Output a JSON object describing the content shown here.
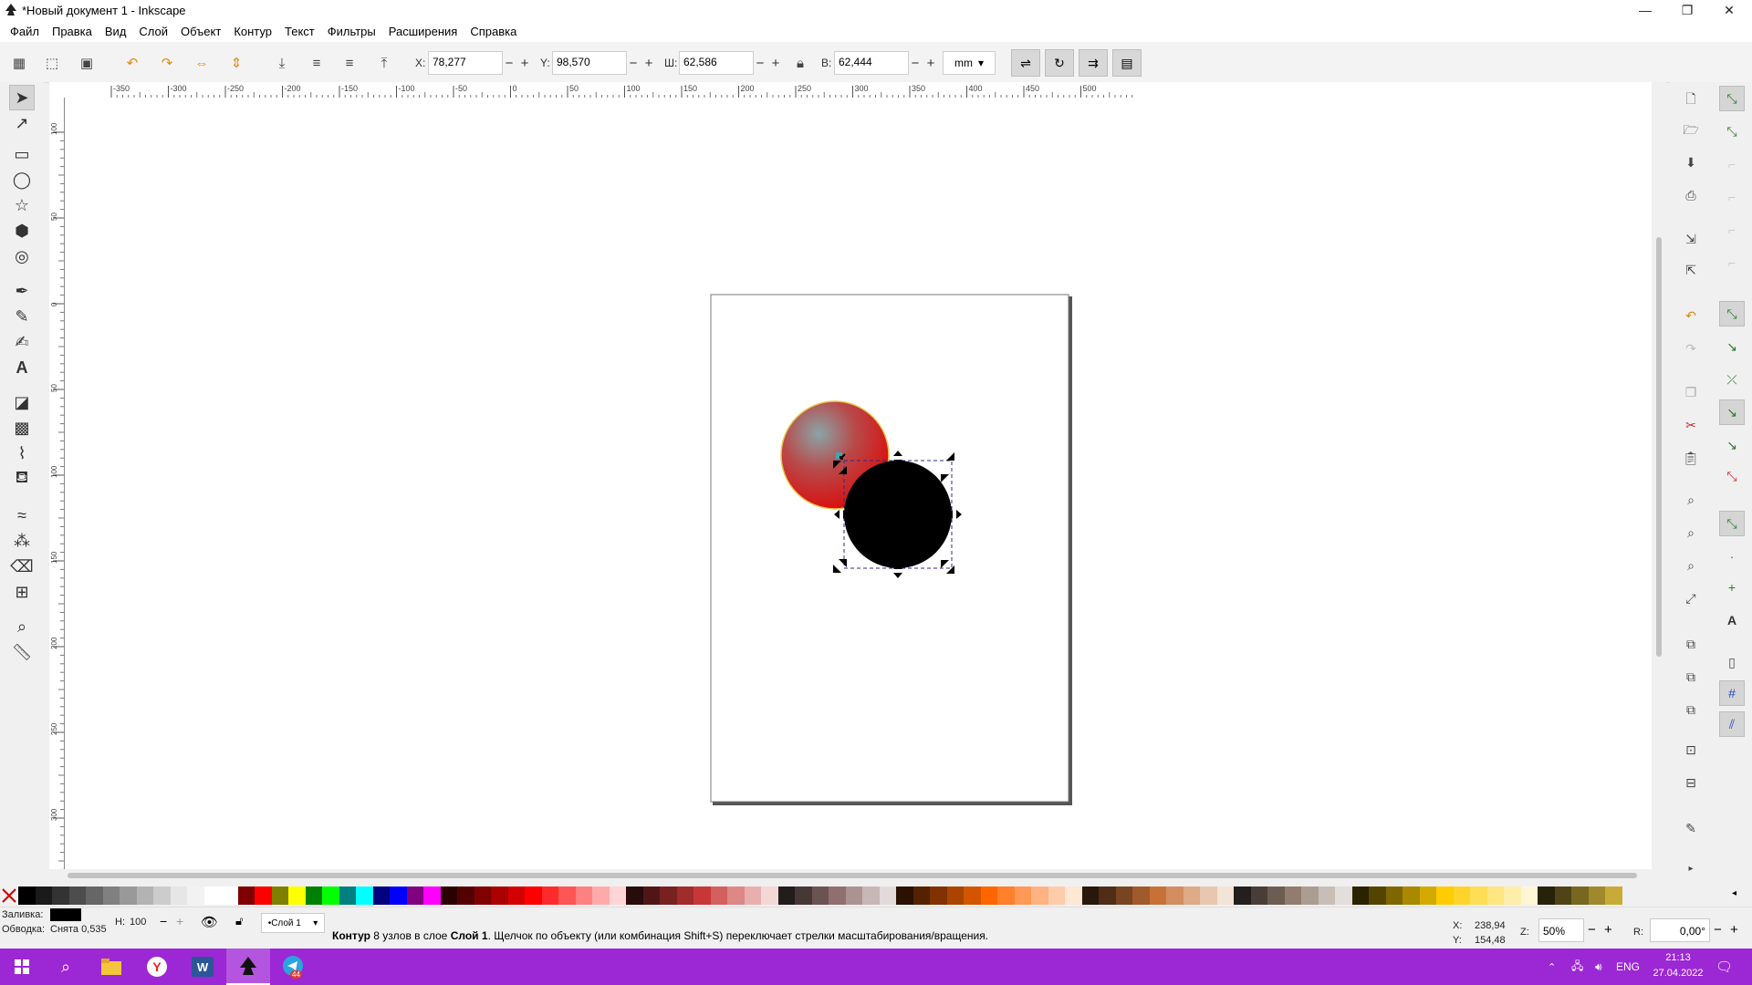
{
  "window": {
    "title": "*Новый документ 1 - Inkscape",
    "minimize": "—",
    "maximize": "❐",
    "close": "✕"
  },
  "menu": [
    "Файл",
    "Правка",
    "Вид",
    "Слой",
    "Объект",
    "Контур",
    "Текст",
    "Фильтры",
    "Расширения",
    "Справка"
  ],
  "toolbar": {
    "x_label": "X:",
    "x_value": "78,277",
    "y_label": "Y:",
    "y_value": "98,570",
    "w_label": "Ш:",
    "w_value": "62,586",
    "h_label": "В:",
    "h_value": "62,444",
    "unit": "mm",
    "spin_minus": "−",
    "spin_plus": "+"
  },
  "ruler": {
    "h_labels": [
      "-350",
      "-300",
      "-250",
      "-200",
      "-150",
      "-100",
      "-50",
      "0",
      "50",
      "100",
      "150",
      "200",
      "250",
      "300",
      "350",
      "400",
      "450",
      "500"
    ],
    "v_labels": [
      "100",
      "50",
      "0",
      "50",
      "100",
      "150",
      "200",
      "250",
      "300"
    ]
  },
  "palette": [
    "#000000",
    "#1a1a1a",
    "#333333",
    "#4d4d4d",
    "#666666",
    "#808080",
    "#999999",
    "#b3b3b3",
    "#cccccc",
    "#e6e6e6",
    "#f2f2f2",
    "#ffffff",
    "#ffffff",
    "#800000",
    "#ff0000",
    "#808000",
    "#ffff00",
    "#008000",
    "#00ff00",
    "#008080",
    "#00ffff",
    "#000080",
    "#0000ff",
    "#800080",
    "#ff00ff",
    "#2b0000",
    "#550000",
    "#800000",
    "#aa0000",
    "#d40000",
    "#ff0000",
    "#ff2a2a",
    "#ff5555",
    "#ff8080",
    "#ffaaaa",
    "#ffd5d5",
    "#280b0b",
    "#501616",
    "#782121",
    "#a02c2c",
    "#c83737",
    "#d35f5f",
    "#de8787",
    "#e9afaf",
    "#f4d7d7",
    "#241c1c",
    "#483737",
    "#6c5353",
    "#916f6f",
    "#ac9393",
    "#c8b7b7",
    "#e3dbdb",
    "#2b1100",
    "#552200",
    "#803300",
    "#aa4400",
    "#d45500",
    "#ff6600",
    "#ff7f2a",
    "#ff9955",
    "#ffb380",
    "#ffccaa",
    "#ffe6d5",
    "#28170b",
    "#502d16",
    "#784421",
    "#a05a2c",
    "#c87137",
    "#d38d5f",
    "#deaa87",
    "#e9c6af",
    "#f4e3d7",
    "#241f1c",
    "#483e37",
    "#6c5d53",
    "#917c6f",
    "#ac9d93",
    "#c8beb7",
    "#e3dedb",
    "#2b2200",
    "#554400",
    "#806600",
    "#aa8800",
    "#d4aa00",
    "#ffcc00",
    "#ffd42a",
    "#ffdd55",
    "#ffe680",
    "#ffeeaa",
    "#fff6d5",
    "#28220b",
    "#504416",
    "#786721",
    "#a0892c",
    "#c8ab37"
  ],
  "status": {
    "fill_label": "Заливка:",
    "stroke_label": "Обводка:",
    "stroke_value": "Снята 0,535",
    "opacity_label": "Н:",
    "opacity_value": "100",
    "layer_name": "•Слой 1",
    "msg_bold1": "Контур",
    "msg_text1": " 8 узлов в слое ",
    "msg_bold2": "Слой 1",
    "msg_text2": ". Щелчок по объекту (или комбинация Shift+S) переключает стрелки масштабирования/вращения.",
    "cursor_x_label": "X:",
    "cursor_x": "238,94",
    "cursor_y_label": "Y:",
    "cursor_y": "154,48",
    "zoom_label": "Z:",
    "zoom": "50%",
    "rotate_label": "R:",
    "rotate": "0,00°"
  },
  "taskbar": {
    "lang": "ENG",
    "time": "21:13",
    "date": "27.04.2022",
    "telegram_badge": "44"
  },
  "colors": {
    "taskbar": "#9c27d4",
    "selection_dash": "#2b2b8c",
    "red_circle": "#d01010",
    "black_circle": "#000000"
  }
}
